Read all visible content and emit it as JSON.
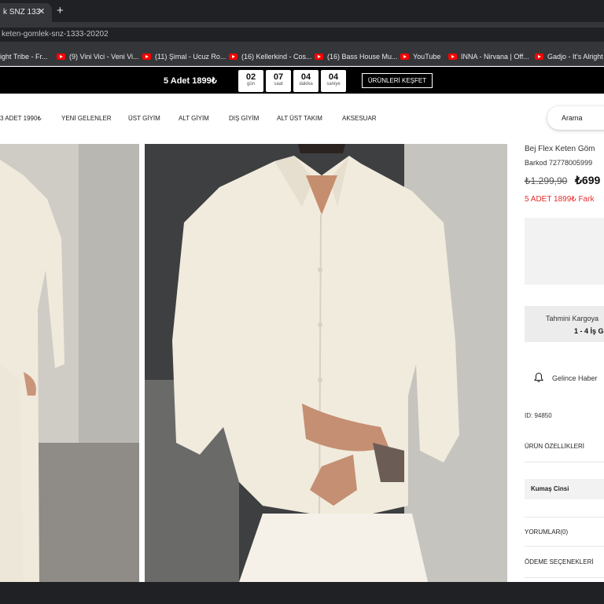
{
  "browser": {
    "tab_title": "k SNZ 133",
    "tab_close": "✕",
    "new_tab": "+",
    "url": "keten-gomlek-snz-1333-20202",
    "bookmarks": [
      {
        "label": "ight Tribe - Fr...",
        "youtube": false
      },
      {
        "label": "(9) Vini Vici - Veni Vi...",
        "youtube": true
      },
      {
        "label": "(11) Şimal - Ucuz Ro...",
        "youtube": true
      },
      {
        "label": "(16) Kellerkind - Cos...",
        "youtube": true
      },
      {
        "label": "(16) Bass House Mu...",
        "youtube": true
      },
      {
        "label": "YouTube",
        "youtube": true
      },
      {
        "label": "INNA - Nirvana | Off...",
        "youtube": true
      },
      {
        "label": "Gadjo - It's Alright (",
        "youtube": true
      }
    ]
  },
  "promo": {
    "text": "5 Adet 1899₺",
    "countdown": [
      {
        "value": "02",
        "unit": "gün"
      },
      {
        "value": "07",
        "unit": "saat"
      },
      {
        "value": "04",
        "unit": "dakika"
      },
      {
        "value": "04",
        "unit": "saniye"
      }
    ],
    "button": "ÜRÜNLERİ KEŞFET"
  },
  "nav": {
    "items": [
      "3 ADET 1990₺",
      "YENİ GELENLER",
      "ÜST GİYİM",
      "ALT GİYİM",
      "DIŞ GİYİM",
      "ALT ÜST TAKIM",
      "AKSESUAR"
    ],
    "search": "Arama"
  },
  "product": {
    "name": "Bej Flex Keten Göm",
    "barcode": "Barkod 72778005999",
    "old_price": "₺1.299,90",
    "new_price": "₺699",
    "campaign": "5 ADET 1899₺ Fark",
    "shipping_label": "Tahmini Kargoya",
    "shipping_value": "1 - 4 İş G",
    "notify": "Gelince Haber",
    "id": "ID: 94850",
    "features": "ÜRÜN ÖZELLİKLERİ",
    "fabric": "Kumaş Cinsi",
    "reviews": "YORUMLAR(0)",
    "payment": "ÖDEME SEÇENEKLERİ"
  },
  "colors": {
    "accent_red": "#e52d2d",
    "promo_bg": "#000000",
    "shirt": "#f1ebdd"
  }
}
